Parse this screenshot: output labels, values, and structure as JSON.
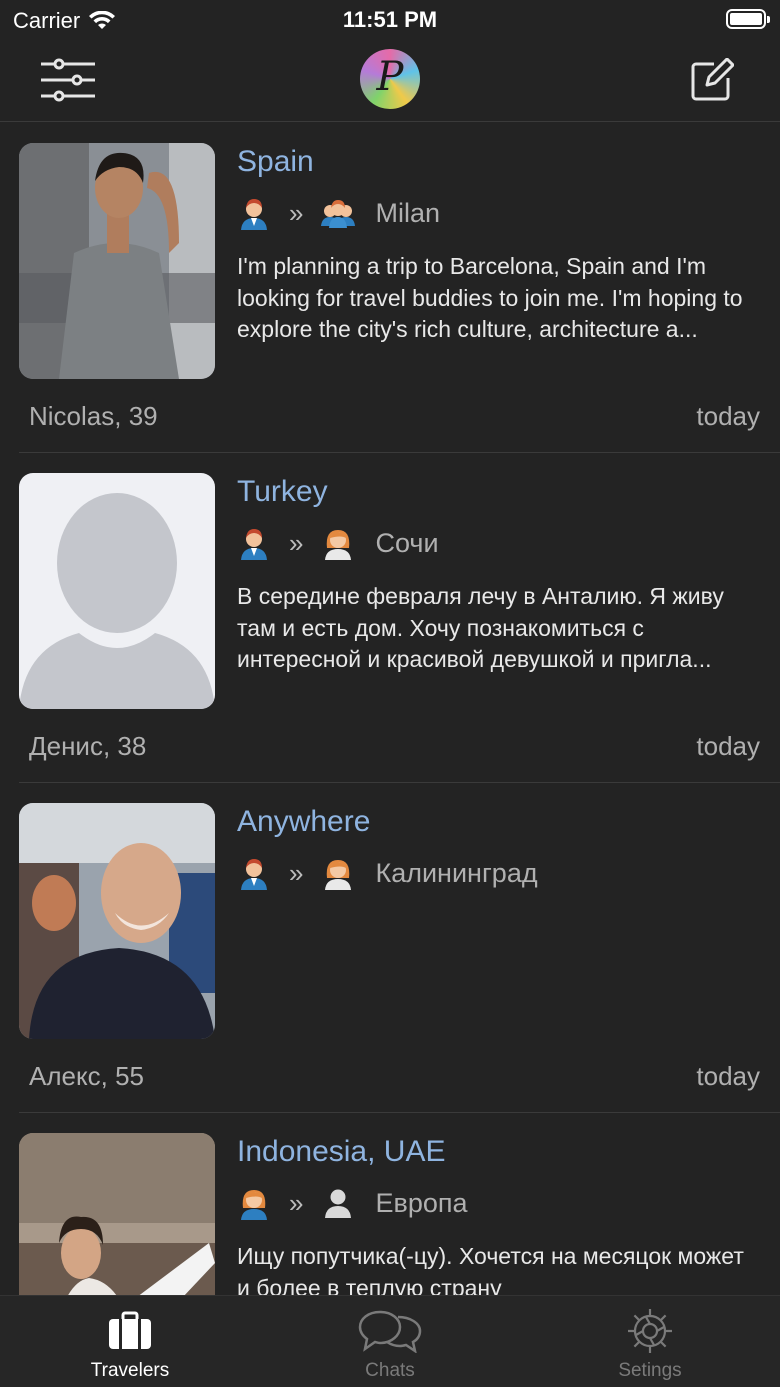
{
  "status_bar": {
    "carrier": "Carrier",
    "time": "11:51 PM"
  },
  "header": {
    "logo_letter": "P"
  },
  "posts": [
    {
      "destination": "Spain",
      "from_icon": "man-avatar-icon",
      "to_icon": "group-avatar-icon",
      "city": "Milan",
      "description": "I'm planning a trip to Barcelona, Spain and I'm looking for travel buddies to join me. I'm hoping to explore the city's rich culture, architecture a...",
      "author": "Nicolas, 39",
      "date": "today"
    },
    {
      "destination": "Turkey",
      "from_icon": "man-avatar-icon",
      "to_icon": "woman-avatar-icon",
      "city": "Сочи",
      "description": "В середине февраля лечу в Анталию. Я живу там и есть дом. Хочу познакомиться с интересной и красивой девушкой и пригла...",
      "author": "Денис, 38",
      "date": "today"
    },
    {
      "destination": "Anywhere",
      "from_icon": "man-avatar-icon",
      "to_icon": "woman-avatar-icon",
      "city": "Калининград",
      "description": "",
      "author": "Алекс, 55",
      "date": "today"
    },
    {
      "destination": "Indonesia, UAE",
      "from_icon": "woman-avatar-icon",
      "to_icon": "person-silhouette-icon",
      "city": "Европа",
      "description": "Ищу попутчика(-цу). Хочется на месяцок может и более в теплую страну",
      "author": "",
      "date": ""
    }
  ],
  "tabs": [
    {
      "label": "Travelers",
      "icon": "suitcase-icon",
      "active": true
    },
    {
      "label": "Chats",
      "icon": "chat-bubbles-icon",
      "active": false
    },
    {
      "label": "Setings",
      "icon": "gear-icon",
      "active": false
    }
  ],
  "colors": {
    "background": "#232323",
    "destination": "#8fb4e0",
    "tab_active": "#ffffff",
    "tab_inactive": "#7a7a7a"
  }
}
